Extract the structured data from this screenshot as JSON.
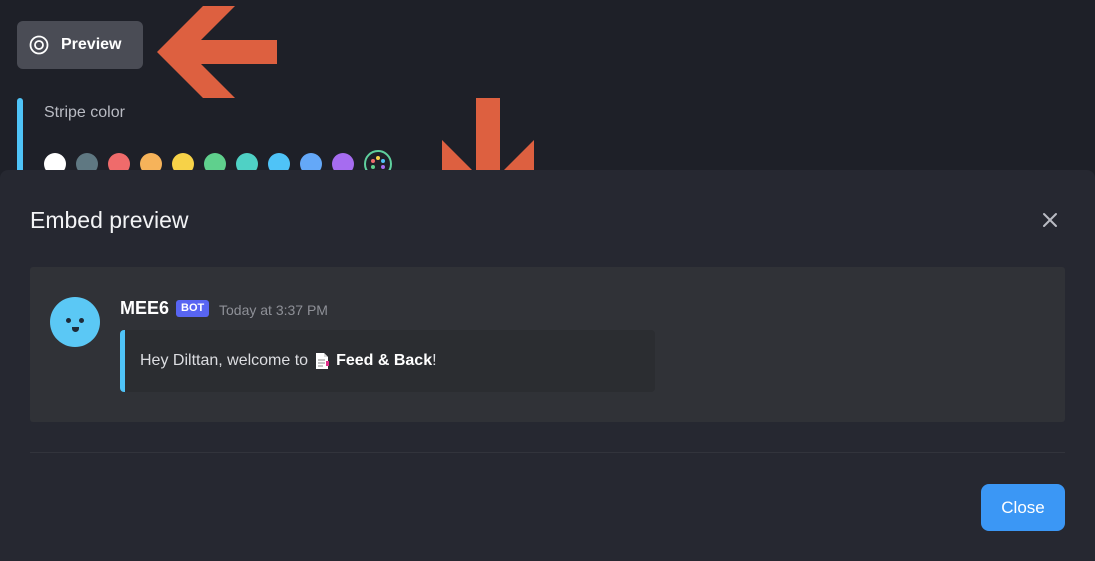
{
  "editor": {
    "preview_label": "Preview",
    "stripe_label": "Stripe color",
    "swatch_colors": [
      "#ffffff",
      "#5f7882",
      "#ef6b6b",
      "#f6b35a",
      "#f7d248",
      "#5fd08d",
      "#4fd1c5",
      "#4fc3f7",
      "#64a8f8",
      "#a66cf0"
    ]
  },
  "modal": {
    "title": "Embed preview",
    "message": {
      "username": "MEE6",
      "badge": "BOT",
      "timestamp": "Today at 3:37 PM",
      "embed_prefix": "Hey Dilttan, welcome to",
      "embed_bold": "Feed & Back",
      "embed_suffix": "!",
      "stripe_color": "#4fc3f7"
    },
    "close_label": "Close"
  },
  "colors": {
    "arrow": "#dd6040",
    "accent": "#3b97f5"
  }
}
